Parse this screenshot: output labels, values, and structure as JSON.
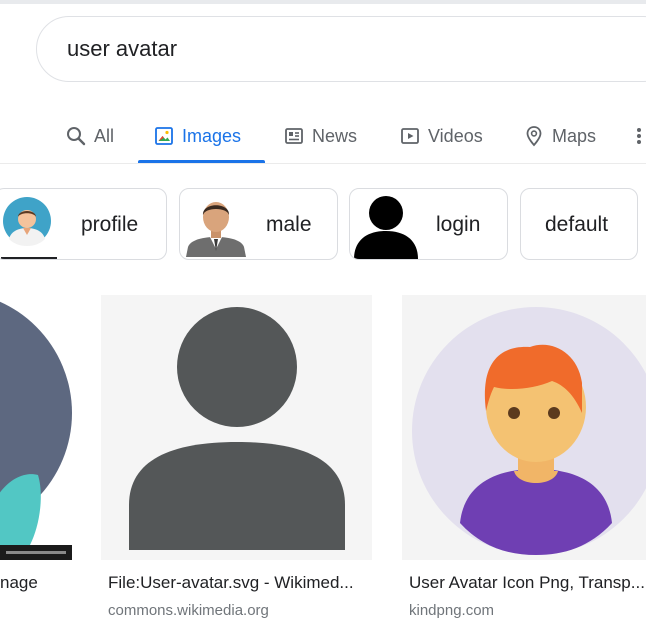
{
  "search": {
    "query": "user avatar"
  },
  "tabs": [
    {
      "label": "All",
      "icon": "search-icon"
    },
    {
      "label": "Images",
      "icon": "image-icon",
      "active": true
    },
    {
      "label": "News",
      "icon": "news-icon"
    },
    {
      "label": "Videos",
      "icon": "video-icon"
    },
    {
      "label": "Maps",
      "icon": "map-pin-icon"
    },
    {
      "label": "",
      "icon": "more-vert-icon"
    }
  ],
  "chips": [
    {
      "label": "profile"
    },
    {
      "label": "male"
    },
    {
      "label": "login"
    },
    {
      "label": "default"
    }
  ],
  "results": [
    {
      "title": "nage",
      "source": ""
    },
    {
      "title": "File:User-avatar.svg - Wikimed...",
      "source": "commons.wikimedia.org"
    },
    {
      "title": "User Avatar Icon Png, Transp...",
      "source": "kindpng.com"
    }
  ],
  "colors": {
    "accent": "#1a73e8",
    "tab_text": "#5f6368",
    "source_text": "#70757a"
  }
}
